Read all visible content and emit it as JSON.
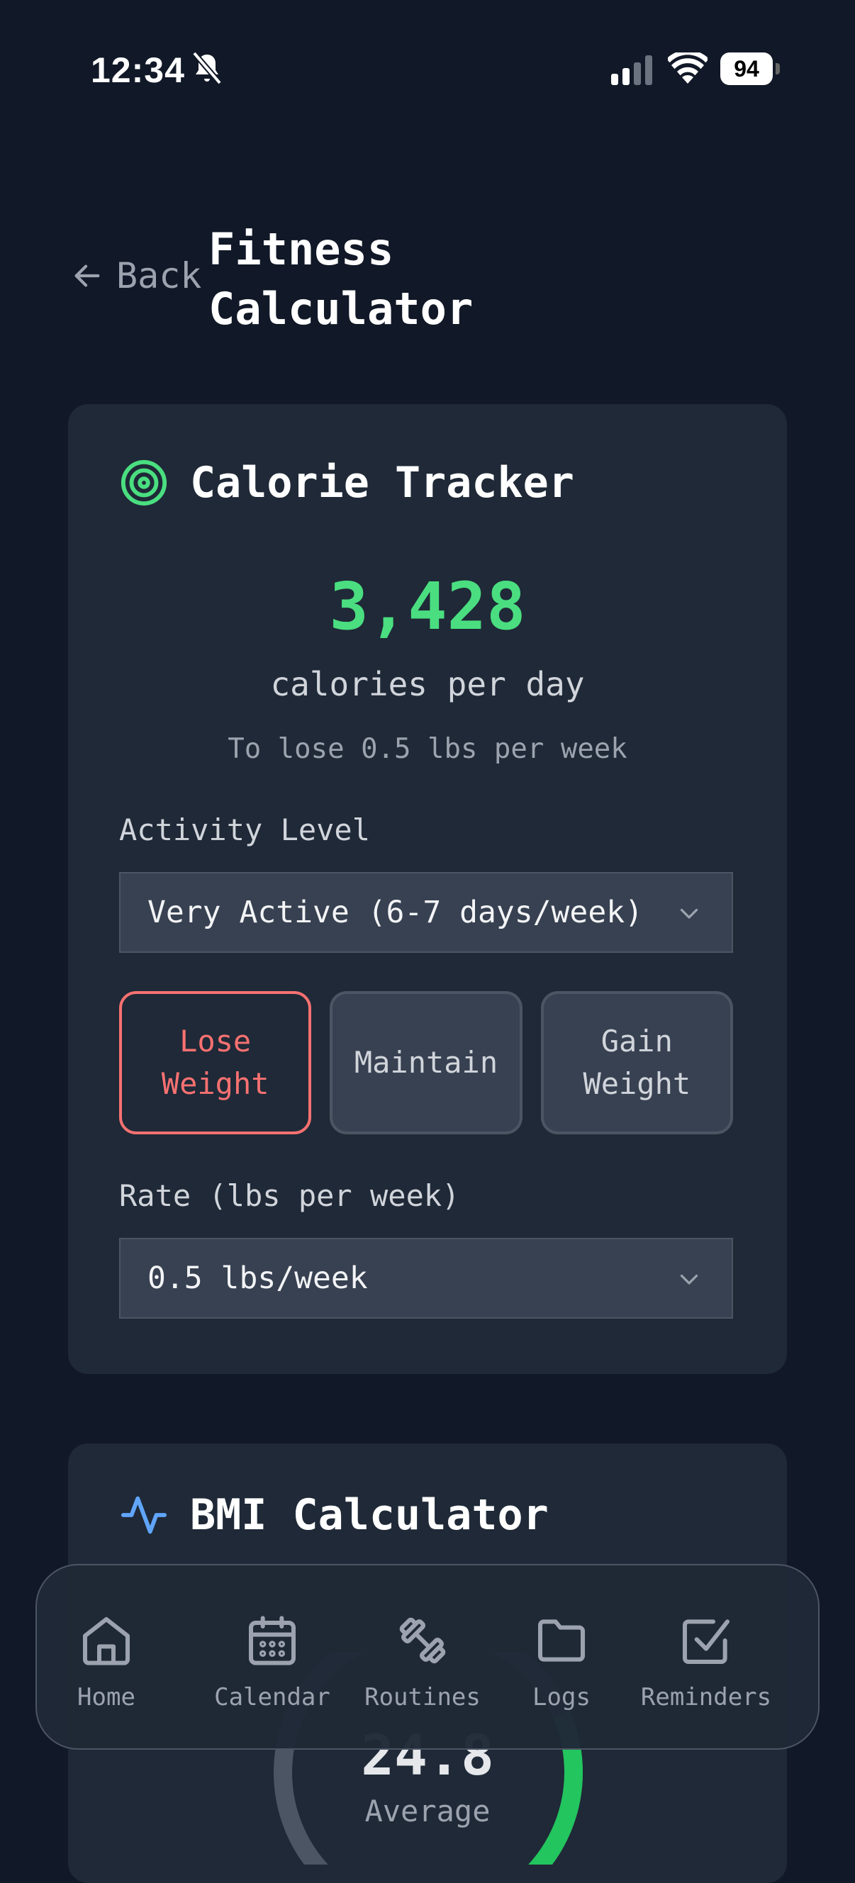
{
  "status": {
    "time": "12:34",
    "battery": "94"
  },
  "header": {
    "back_label": "Back",
    "title": "Fitness Calculator"
  },
  "calorie": {
    "title": "Calorie Tracker",
    "value": "3,428",
    "unit": "calories per day",
    "goal_text": "To lose 0.5 lbs per week",
    "activity_label": "Activity Level",
    "activity_value": "Very Active (6-7 days/week)",
    "goals": [
      "Lose Weight",
      "Maintain",
      "Gain Weight"
    ],
    "selected_goal": "Lose Weight",
    "rate_label": "Rate (lbs per week)",
    "rate_value": "0.5 lbs/week",
    "accent": "#4ade80",
    "selected_color": "#f87171"
  },
  "bmi": {
    "title": "BMI Calculator",
    "value": "24.8",
    "value_label": "Average",
    "gauge_color": "#22c55e"
  },
  "nav": {
    "items": [
      {
        "label": "Home",
        "icon": "home-icon"
      },
      {
        "label": "Calendar",
        "icon": "calendar-icon"
      },
      {
        "label": "Routines",
        "icon": "dumbbell-icon"
      },
      {
        "label": "Logs",
        "icon": "folder-icon"
      },
      {
        "label": "Reminders",
        "icon": "checkbox-icon"
      }
    ]
  }
}
